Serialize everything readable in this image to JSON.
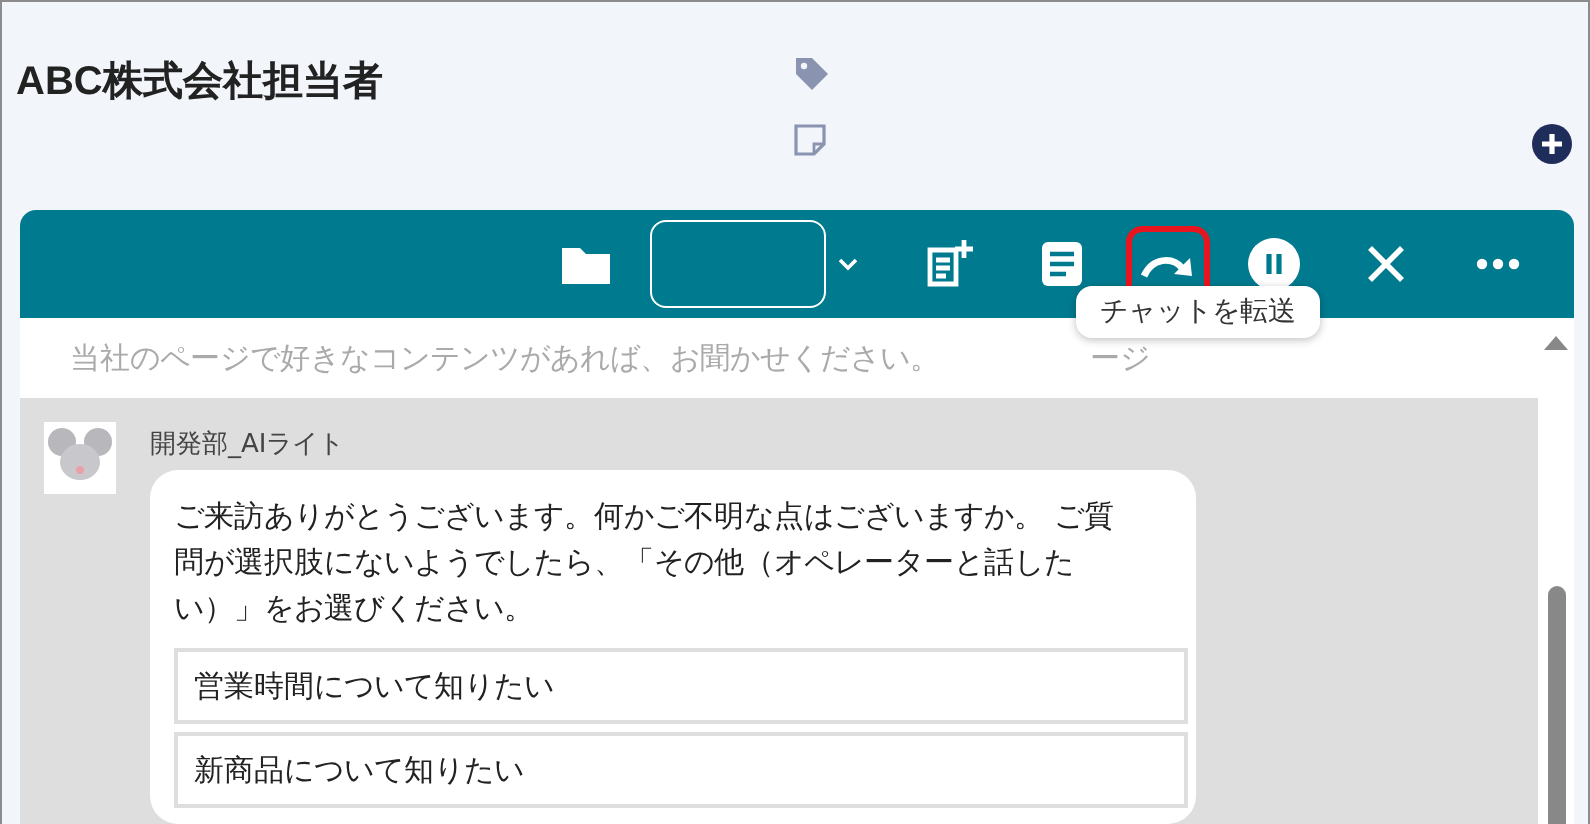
{
  "header": {
    "title": "ABC株式会社担当者"
  },
  "toolbar": {
    "items": [
      {
        "kind": "folder",
        "highlighted": false
      },
      {
        "kind": "select",
        "highlighted": false
      },
      {
        "kind": "note-add",
        "highlighted": false
      },
      {
        "kind": "document",
        "highlighted": false
      },
      {
        "kind": "forward",
        "highlighted": true
      },
      {
        "kind": "pause",
        "highlighted": false
      },
      {
        "kind": "close",
        "highlighted": false
      },
      {
        "kind": "more",
        "highlighted": false
      }
    ],
    "tooltip": "チャットを転送"
  },
  "chat": {
    "previous_message": {
      "text": "当社のページで好きなコンテンツがあれば、お聞かせください。",
      "tail": "ージ"
    },
    "bot_message": {
      "sender": "開発部_AIライト",
      "text": "ご来訪ありがとうございます。何かご不明な点はございますか。 ご質問が選択肢にないようでしたら、「その他（オペレーターと話したい）」をお選びください。",
      "options": [
        "営業時間について知りたい",
        "新商品について知りたい"
      ]
    }
  }
}
